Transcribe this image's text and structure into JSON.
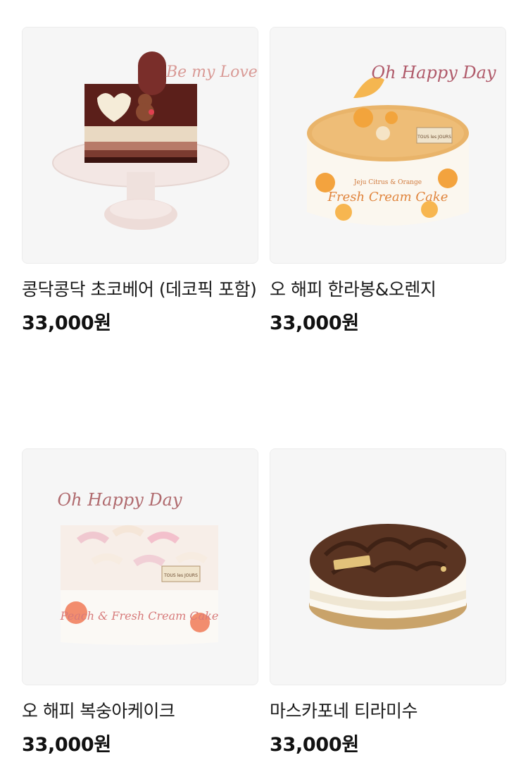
{
  "products": [
    {
      "name": "콩닥콩닥 초코베어 (데코픽 포함)",
      "price": "33,000원",
      "image": "choco-bear-cake-image",
      "topper_text": "Be my Love"
    },
    {
      "name": "오 해피 한라봉&오렌지",
      "price": "33,000원",
      "image": "hallabong-orange-cake-image",
      "topper_text": "Oh Happy Day",
      "box_brand": "TOUS les JOURS",
      "box_text_small": "Jeju Citrus & Orange",
      "box_text": "Fresh Cream Cake"
    },
    {
      "name": "오 해피 복숭아케이크",
      "price": "33,000원",
      "image": "peach-cake-image",
      "topper_text": "Oh Happy Day",
      "box_brand": "TOUS les JOURS",
      "box_text": "Peach & Fresh Cream Cake"
    },
    {
      "name": "마스카포네 티라미수",
      "price": "33,000원",
      "image": "tiramisu-cake-image"
    }
  ]
}
